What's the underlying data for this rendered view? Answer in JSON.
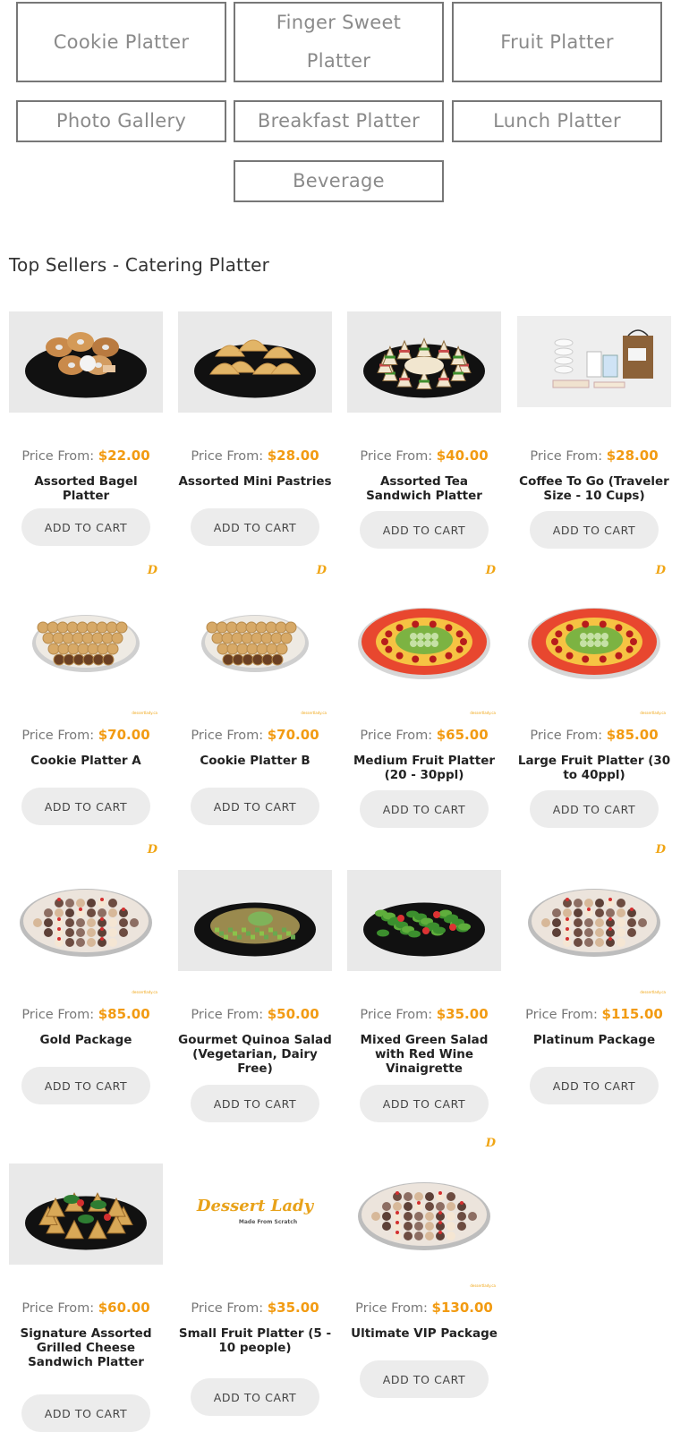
{
  "categories": [
    {
      "label": "Cookie Platter"
    },
    {
      "label": "Finger Sweet Platter"
    },
    {
      "label": "Fruit Platter"
    },
    {
      "label": "Photo Gallery"
    },
    {
      "label": "Breakfast Platter"
    },
    {
      "label": "Lunch Platter"
    },
    {
      "label": "Beverage"
    }
  ],
  "section_title": "Top Sellers - Catering Platter",
  "price_prefix": "Price From:",
  "add_to_cart_label": "ADD TO CART",
  "brand_mark": "D",
  "brand_footer": "dessertlady.ca",
  "logo": {
    "name": "Dessert Lady",
    "tagline": "Made From Scratch"
  },
  "products": [
    {
      "name": "Assorted Bagel Platter",
      "price": "$22.00",
      "image": "bagel-platter"
    },
    {
      "name": "Assorted Mini Pastries",
      "price": "$28.00",
      "image": "mini-pastries"
    },
    {
      "name": "Assorted Tea Sandwich Platter",
      "price": "$40.00",
      "image": "tea-sandwich"
    },
    {
      "name": "Coffee To Go (Traveler Size - 10 Cups)",
      "price": "$28.00",
      "image": "coffee-to-go"
    },
    {
      "name": "Cookie Platter A",
      "price": "$70.00",
      "image": "cookie-platter"
    },
    {
      "name": "Cookie Platter B",
      "price": "$70.00",
      "image": "cookie-platter"
    },
    {
      "name": "Medium Fruit Platter (20 - 30ppl)",
      "price": "$65.00",
      "image": "fruit-platter"
    },
    {
      "name": "Large Fruit Platter (30 to 40ppl)",
      "price": "$85.00",
      "image": "fruit-platter"
    },
    {
      "name": "Gold Package",
      "price": "$85.00",
      "image": "dessert-platter"
    },
    {
      "name": "Gourmet Quinoa Salad (Vegetarian, Dairy Free)",
      "price": "$50.00",
      "image": "quinoa-salad"
    },
    {
      "name": "Mixed Green Salad with Red Wine Vinaigrette",
      "price": "$35.00",
      "image": "green-salad"
    },
    {
      "name": "Platinum Package",
      "price": "$115.00",
      "image": "dessert-platter"
    },
    {
      "name": "Signature Assorted Grilled Cheese Sandwich Platter",
      "price": "$60.00",
      "image": "grilled-cheese"
    },
    {
      "name": "Small Fruit Platter (5 - 10 people)",
      "price": "$35.00",
      "image": "logo-placeholder"
    },
    {
      "name": "Ultimate VIP Package",
      "price": "$130.00",
      "image": "dessert-platter"
    }
  ],
  "colors": {
    "accent": "#f29b12",
    "button_bg": "#ececec",
    "border": "#777777"
  }
}
